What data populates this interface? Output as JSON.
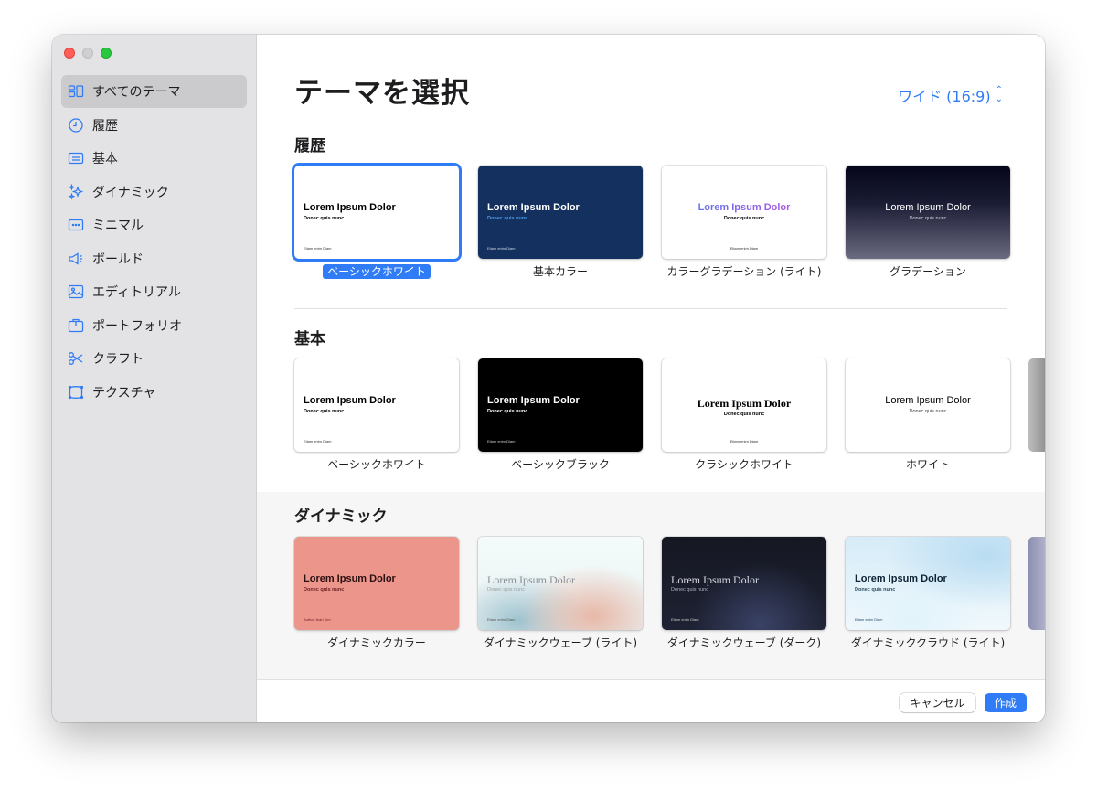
{
  "window": {
    "title": "テーマを選択"
  },
  "sidebar": {
    "items": [
      {
        "label": "すべてのテーマ",
        "icon": "grid-icon",
        "selected": true
      },
      {
        "label": "履歴",
        "icon": "clock-icon"
      },
      {
        "label": "基本",
        "icon": "card-icon"
      },
      {
        "label": "ダイナミック",
        "icon": "sparkles-icon"
      },
      {
        "label": "ミニマル",
        "icon": "dots-box-icon"
      },
      {
        "label": "ボールド",
        "icon": "megaphone-icon"
      },
      {
        "label": "エディトリアル",
        "icon": "photo-icon"
      },
      {
        "label": "ポートフォリオ",
        "icon": "briefcase-icon"
      },
      {
        "label": "クラフト",
        "icon": "scissors-icon"
      },
      {
        "label": "テクスチャ",
        "icon": "texture-icon"
      }
    ]
  },
  "header": {
    "title": "テーマを選択",
    "ratio_label": "ワイド (16:9)"
  },
  "sections": {
    "recent": {
      "title": "履歴",
      "themes": [
        {
          "caption": "ベーシックホワイト",
          "title": "Lorem Ipsum Dolor",
          "subtitle": "Donec quis nunc",
          "footer": "Etiam enim Diam",
          "selected": true
        },
        {
          "caption": "基本カラー",
          "title": "Lorem Ipsum Dolor",
          "subtitle": "Donec quis nunc",
          "footer": "Etiam enim Diam"
        },
        {
          "caption": "カラーグラデーション (ライト)",
          "title": "Lorem Ipsum Dolor",
          "subtitle": "Donec quis nunc",
          "footer": "Etiam enim Diam"
        },
        {
          "caption": "グラデーション",
          "title": "Lorem Ipsum Dolor",
          "subtitle": "Donec quis nunc",
          "footer": ""
        }
      ]
    },
    "basic": {
      "title": "基本",
      "themes": [
        {
          "caption": "ベーシックホワイト",
          "title": "Lorem Ipsum Dolor",
          "subtitle": "Donec quis nunc",
          "footer": "Etiam enim Diam"
        },
        {
          "caption": "ベーシックブラック",
          "title": "Lorem Ipsum Dolor",
          "subtitle": "Donec quis nunc",
          "footer": "Etiam enim Diam"
        },
        {
          "caption": "クラシックホワイト",
          "title": "Lorem Ipsum Dolor",
          "subtitle": "Donec quis nunc",
          "footer": "Etiam enim Diam"
        },
        {
          "caption": "ホワイト",
          "title": "Lorem Ipsum Dolor",
          "subtitle": "Donec quis nunc",
          "footer": ""
        }
      ]
    },
    "dynamic": {
      "title": "ダイナミック",
      "themes": [
        {
          "caption": "ダイナミックカラー",
          "title": "Lorem Ipsum Dolor",
          "subtitle": "Donec quis nunc",
          "footer": "Author Jean Kim"
        },
        {
          "caption": "ダイナミックウェーブ (ライト)",
          "title": "Lorem Ipsum Dolor",
          "subtitle": "Donec quis nunc",
          "footer": "Etiam enim Diam"
        },
        {
          "caption": "ダイナミックウェーブ (ダーク)",
          "title": "Lorem Ipsum Dolor",
          "subtitle": "Donec quis nunc",
          "footer": "Etiam enim Diam"
        },
        {
          "caption": "ダイナミッククラウド (ライト)",
          "title": "Lorem Ipsum Dolor",
          "subtitle": "Donec quis nunc",
          "footer": "Etiam enim Diam"
        }
      ]
    }
  },
  "footer": {
    "cancel_label": "キャンセル",
    "create_label": "作成"
  },
  "colors": {
    "accent": "#2f7cf6",
    "sidebar_bg": "#e3e3e5"
  }
}
